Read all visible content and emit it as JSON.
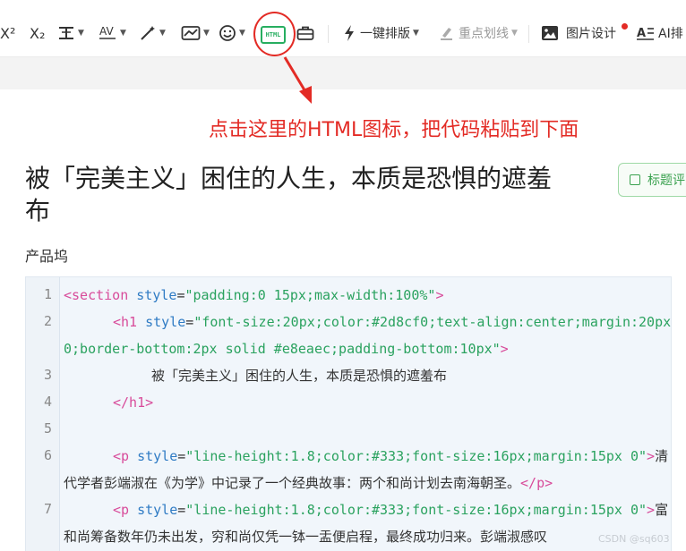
{
  "toolbar": {
    "superscript": "X²",
    "subscript": "X₂",
    "one_click_layout": "一键排版",
    "highlight_underline": "重点划线",
    "image_design": "图片设计",
    "ai_layout": "AI排",
    "html_label": "HTML",
    "accent_color": "#27ae60",
    "icons": [
      "superscript-icon",
      "subscript-icon",
      "line-height-icon",
      "letter-spacing-icon",
      "magic-wand-icon",
      "chart-icon",
      "emoji-icon",
      "html-icon",
      "toolbox-icon",
      "lightning-icon",
      "highlighter-icon",
      "image-icon",
      "ai-text-icon"
    ]
  },
  "annotation": {
    "text": "点击这里的HTML图标，把代码粘贴到下面",
    "color": "#e32b25"
  },
  "article": {
    "title": "被「完美主义」困住的人生，本质是恐惧的遮羞布",
    "author": "产品坞",
    "title_eval_button": "标题评"
  },
  "code": {
    "lines": [
      {
        "n": "1",
        "parts": [
          [
            "tag",
            "<section "
          ],
          [
            "attr",
            "style"
          ],
          [
            "txt",
            "="
          ],
          [
            "str",
            "\"padding:0 15px;max-width:100%\""
          ],
          [
            "tag",
            ">"
          ]
        ],
        "indent": 0
      },
      {
        "n": "2",
        "parts": [
          [
            "tag",
            "<h1 "
          ],
          [
            "attr",
            "style"
          ],
          [
            "txt",
            "="
          ],
          [
            "str",
            "\"font-size:20px;color:#2d8cf0;text-align:center;margin:20px"
          ]
        ],
        "indent": 1
      },
      {
        "n": "",
        "parts": [
          [
            "str",
            "0;border-bottom:2px solid #e8eaec;padding-bottom:10px\""
          ],
          [
            "tag",
            ">"
          ]
        ],
        "indent": 0
      },
      {
        "n": "3",
        "parts": [
          [
            "txt",
            "被「完美主义」困住的人生，本质是恐惧的遮羞布"
          ]
        ],
        "indent": 2
      },
      {
        "n": "4",
        "parts": [
          [
            "tag",
            "</h1>"
          ]
        ],
        "indent": 1
      },
      {
        "n": "5",
        "parts": [],
        "indent": 0
      },
      {
        "n": "6",
        "parts": [
          [
            "tag",
            "<p "
          ],
          [
            "attr",
            "style"
          ],
          [
            "txt",
            "="
          ],
          [
            "str",
            "\"line-height:1.8;color:#333;font-size:16px;margin:15px 0\""
          ],
          [
            "tag",
            ">"
          ],
          [
            "txt",
            "清"
          ]
        ],
        "indent": 1
      },
      {
        "n": "",
        "parts": [
          [
            "txt",
            "代学者彭端淑在《为学》中记录了一个经典故事：两个和尚计划去南海朝圣。"
          ],
          [
            "tag",
            "</p>"
          ]
        ],
        "indent": 0
      },
      {
        "n": "7",
        "parts": [
          [
            "tag",
            "<p "
          ],
          [
            "attr",
            "style"
          ],
          [
            "txt",
            "="
          ],
          [
            "str",
            "\"line-height:1.8;color:#333;font-size:16px;margin:15px 0\""
          ],
          [
            "tag",
            ">"
          ],
          [
            "txt",
            "富"
          ]
        ],
        "indent": 1
      },
      {
        "n": "",
        "parts": [
          [
            "txt",
            "和尚筹备数年仍未出发，穷和尚仅凭一钵一盂便启程，最终成功归来。彭端淑感叹"
          ]
        ],
        "indent": 0
      }
    ]
  },
  "watermark": "CSDN @sq603"
}
